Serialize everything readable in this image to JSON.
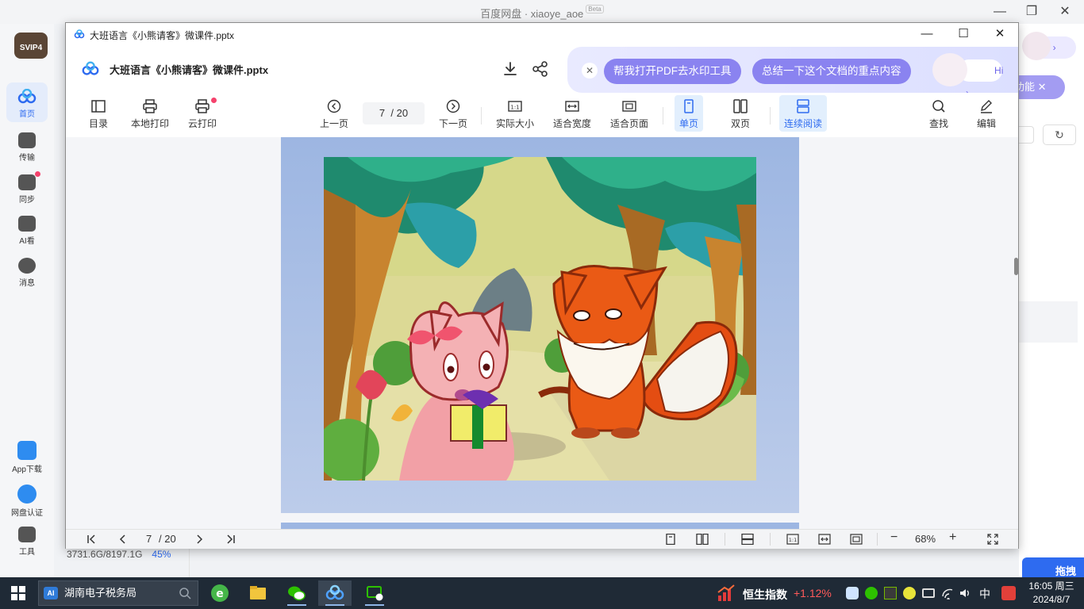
{
  "app": {
    "title": "百度网盘 · xiaoye_aoe",
    "beta": "Beta",
    "logo_text": "SVIP4",
    "sidebar": [
      {
        "label": "首页"
      },
      {
        "label": "传输"
      },
      {
        "label": "同步"
      },
      {
        "label": "AI看"
      },
      {
        "label": "消息"
      },
      {
        "label": "App下载"
      },
      {
        "label": "网盘认证"
      },
      {
        "label": "工具"
      }
    ],
    "right_hi": "Hi",
    "right_func": "功能",
    "right_bottom": "拖拽至",
    "storage": "3731.6G/8197.1G",
    "storage_pct": "45%"
  },
  "viewer": {
    "window_title": "大班语言《小熊请客》微课件.pptx",
    "doc_title": "大班语言《小熊请客》微课件.pptx",
    "ai_bar": {
      "pill1": "帮我打开PDF去水印工具",
      "pill2": "总结一下这个文档的重点内容",
      "hi": "Hi"
    },
    "toolbar": {
      "toc": "目录",
      "local_print": "本地打印",
      "cloud_print": "云打印",
      "prev": "上一页",
      "page_current": "7",
      "page_total": "/ 20",
      "next": "下一页",
      "actual_size": "实际大小",
      "fit_width": "适合宽度",
      "fit_page": "适合页面",
      "single": "单页",
      "double": "双页",
      "continuous": "连续阅读",
      "find": "查找",
      "edit": "编辑"
    },
    "bottom": {
      "page_current": "7",
      "page_total": "/ 20",
      "zoom": "68%"
    }
  },
  "taskbar": {
    "search_text": "湖南电子税务局",
    "search_ai": "AI",
    "hsi_label": "恒生指数",
    "hsi_value": "+1.12%",
    "ime": "中",
    "time": "16:05 周三",
    "date": "2024/8/7"
  }
}
